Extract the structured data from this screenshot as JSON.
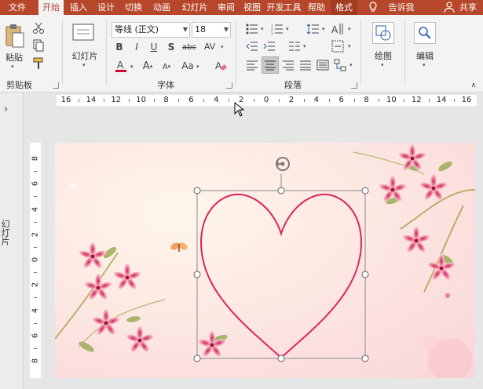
{
  "tabs": [
    "文件",
    "开始",
    "插入",
    "设计",
    "切换",
    "动画",
    "幻灯片",
    "审阅",
    "视图",
    "开发工具",
    "帮助",
    "格式"
  ],
  "tell_me": "告诉我",
  "share": "共享",
  "clipboard": {
    "paste": "粘贴",
    "group": "剪贴板"
  },
  "slides": {
    "button": "幻灯片"
  },
  "font": {
    "name": "等线 (正文)",
    "size": "18",
    "group": "字体"
  },
  "paragraph": {
    "group": "段落"
  },
  "drawing": {
    "label": "绘图"
  },
  "editing": {
    "label": "编辑"
  },
  "ruler_h": [
    "16",
    "14",
    "12",
    "10",
    "8",
    "6",
    "4",
    "2",
    "0",
    "2",
    "4",
    "6",
    "8",
    "10",
    "12",
    "14",
    "16"
  ],
  "ruler_v": [
    "8",
    "6",
    "4",
    "2",
    "0",
    "2",
    "4",
    "6",
    "8"
  ],
  "side_label": "幻灯片",
  "colors": {
    "accent": "#b7472a",
    "heart": "#e0215f"
  }
}
